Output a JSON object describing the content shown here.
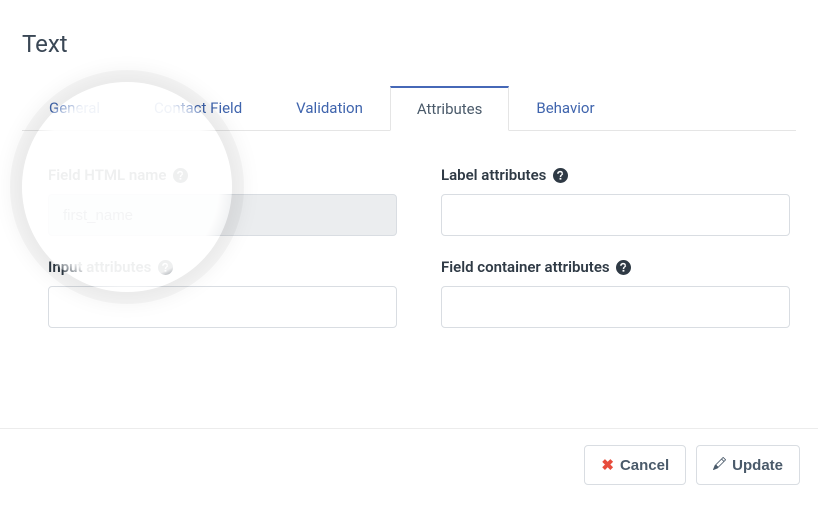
{
  "title": "Text",
  "tabs": {
    "general": "General",
    "contact_field": "Contact Field",
    "validation": "Validation",
    "attributes": "Attributes",
    "behavior": "Behavior",
    "active": "attributes"
  },
  "form": {
    "field_html_name": {
      "label": "Field HTML name",
      "value": "first_name"
    },
    "label_attributes": {
      "label": "Label attributes",
      "value": ""
    },
    "input_attributes": {
      "label": "Input attributes",
      "value": ""
    },
    "field_container_attributes": {
      "label": "Field container attributes",
      "value": ""
    }
  },
  "footer": {
    "cancel": "Cancel",
    "update": "Update"
  }
}
